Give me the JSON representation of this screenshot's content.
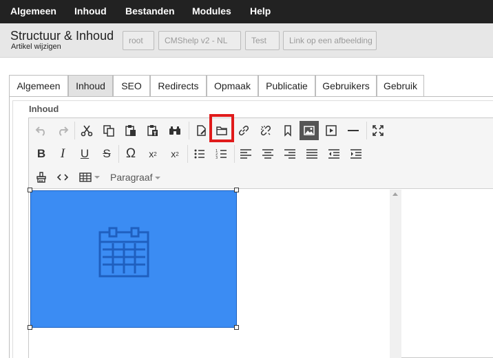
{
  "menu": {
    "items": [
      "Algemeen",
      "Inhoud",
      "Bestanden",
      "Modules",
      "Help"
    ]
  },
  "header": {
    "title": "Structuur & Inhoud",
    "subtitle": "Artikel wijzigen",
    "breadcrumb": [
      "root",
      "CMShelp v2 - NL",
      "Test",
      "Link op een afbeelding"
    ]
  },
  "tabs": [
    "Algemeen",
    "Inhoud",
    "SEO",
    "Redirects",
    "Opmaak",
    "Publicatie",
    "Gebruikers",
    "Gebruik"
  ],
  "active_tab": "Inhoud",
  "editor": {
    "label": "Inhoud",
    "format_dropdown": "Paragraaf",
    "toolbar_icons": [
      "undo-icon",
      "redo-icon",
      "cut-icon",
      "copy-icon",
      "paste-icon",
      "paste-text-icon",
      "find-icon",
      "new-document-icon",
      "file-browser-icon",
      "link-icon",
      "unlink-icon",
      "bookmark-icon",
      "image-icon",
      "media-icon",
      "horizontal-rule-icon",
      "fullscreen-icon",
      "bold-icon",
      "italic-icon",
      "underline-icon",
      "strikethrough-icon",
      "special-char-icon",
      "subscript-icon",
      "superscript-icon",
      "bullet-list-icon",
      "numbered-list-icon",
      "align-left-icon",
      "align-center-icon",
      "align-right-icon",
      "justify-icon",
      "outdent-icon",
      "indent-icon",
      "clear-format-icon",
      "source-code-icon",
      "table-icon"
    ]
  },
  "colors": {
    "topbar": "#222222",
    "highlight": "#e01b1b",
    "image_fill": "#3b8cf3",
    "image_icon": "#1f5fbf"
  }
}
